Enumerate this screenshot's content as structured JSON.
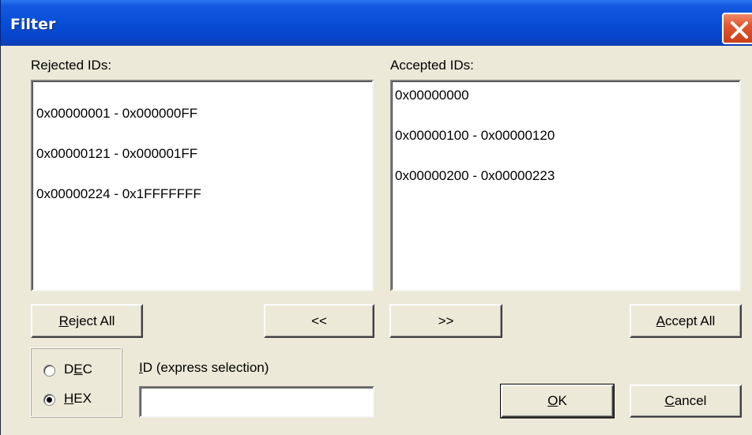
{
  "window": {
    "title": "Filter"
  },
  "rejected": {
    "label": "Rejected IDs:",
    "items": [
      "0x00000001 - 0x000000FF",
      "0x00000121 - 0x000001FF",
      "0x00000224 - 0x1FFFFFFF"
    ]
  },
  "accepted": {
    "label": "Accepted IDs:",
    "items": [
      "0x00000000",
      "0x00000100 - 0x00000120",
      "0x00000200 - 0x00000223"
    ]
  },
  "buttons": {
    "reject_all_pre": "",
    "reject_all_mn": "R",
    "reject_all_post": "eject All",
    "move_left": "<<",
    "move_right": ">>",
    "accept_all_pre": "",
    "accept_all_mn": "A",
    "accept_all_post": "ccept All",
    "ok_pre": "",
    "ok_mn": "O",
    "ok_post": "K",
    "cancel_pre": "",
    "cancel_mn": "C",
    "cancel_post": "ancel"
  },
  "radix": {
    "dec_pre": "D",
    "dec_mn": "E",
    "dec_post": "C",
    "hex_pre": "",
    "hex_mn": "H",
    "hex_post": "EX",
    "selected": "HEX"
  },
  "express": {
    "label_pre": "",
    "label_mn": "I",
    "label_post": "D (express selection)",
    "value": ""
  },
  "colors": {
    "title_bar": "#0a4fd7",
    "close_button": "#e0572f",
    "dialog_bg": "#ece9d8"
  }
}
